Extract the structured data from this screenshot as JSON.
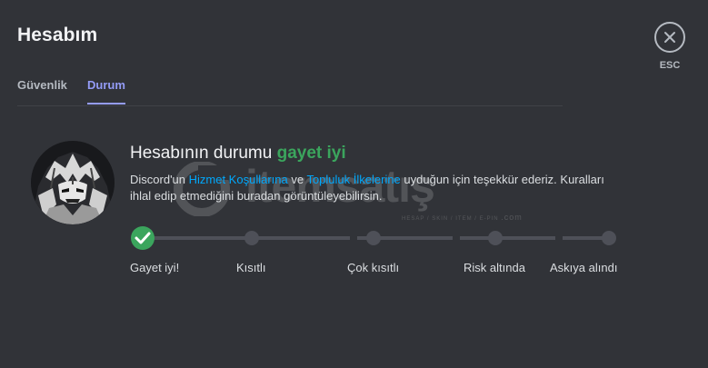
{
  "header": {
    "title": "Hesabım",
    "close_label": "ESC"
  },
  "tabs": [
    {
      "label": "Güvenlik",
      "active": false
    },
    {
      "label": "Durum",
      "active": true
    }
  ],
  "status": {
    "title_prefix": "Hesabının durumu",
    "title_highlight": "gayet iyi",
    "desc_part1": "Discord'un ",
    "desc_link1": "Hizmet Koşullarına",
    "desc_part2": " ve ",
    "desc_link2": "Topluluk İlkelerine",
    "desc_part3": " uyduğun için teşekkür ederiz. Kuralları ihlal edip etmediğini buradan görüntüleyebilirsin."
  },
  "watermark": {
    "brand": "itemsatış",
    "tagline": "HESAP / SKIN / ITEM / E-PIN",
    "domain": ".com"
  },
  "progress": {
    "steps": [
      {
        "label": "Gayet iyi!",
        "current": true
      },
      {
        "label": "Kısıtlı",
        "current": false
      },
      {
        "label": "Çok kısıtlı",
        "current": false
      },
      {
        "label": "Risk altında",
        "current": false
      },
      {
        "label": "Askıya alındı",
        "current": false
      }
    ]
  },
  "colors": {
    "background": "#313338",
    "accent": "#949cf7",
    "status_good": "#3ba55d",
    "link": "#00a8fc",
    "step_inactive": "#4e5058"
  }
}
